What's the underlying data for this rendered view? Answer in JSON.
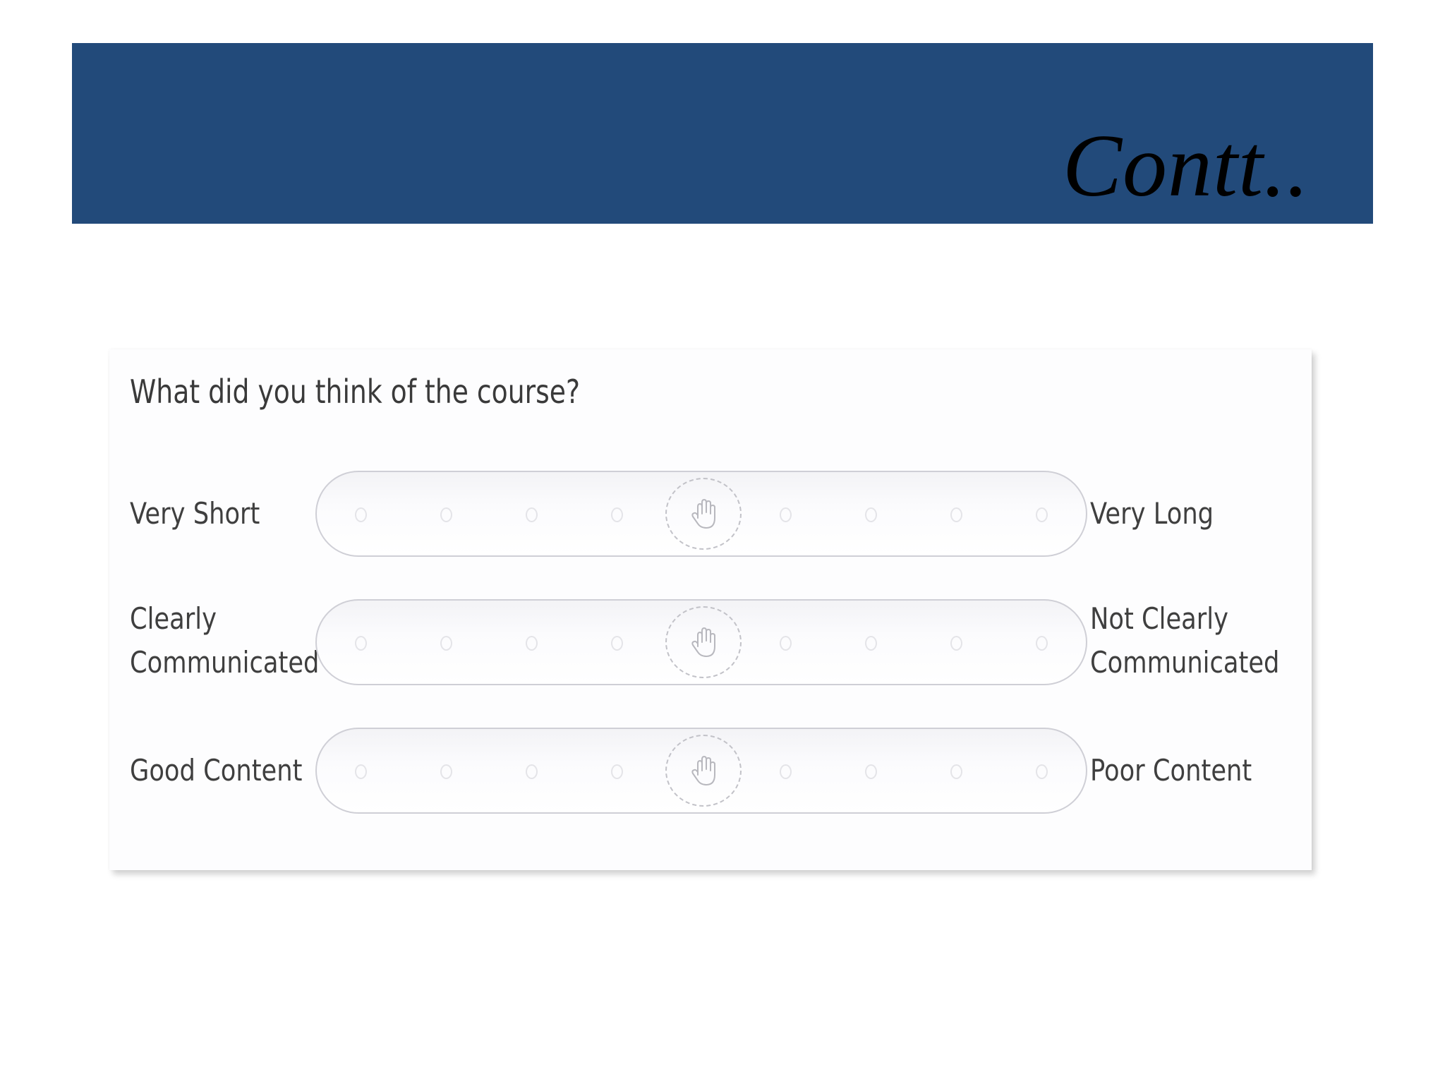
{
  "banner": {
    "title": "Contt..",
    "color": "#224a7a"
  },
  "survey": {
    "question": "What did you think of the course?",
    "rows": [
      {
        "left_label_lines": [
          "Very Short"
        ],
        "right_label_lines": [
          "Very Long"
        ],
        "scale_points": 9,
        "selected": null,
        "handle_icon": "hand-icon"
      },
      {
        "left_label_lines": [
          "Clearly",
          "Communicated"
        ],
        "right_label_lines": [
          "Not Clearly",
          "Communicated"
        ],
        "scale_points": 9,
        "selected": null,
        "handle_icon": "hand-icon"
      },
      {
        "left_label_lines": [
          "Good Content"
        ],
        "right_label_lines": [
          "Poor Content"
        ],
        "scale_points": 9,
        "selected": null,
        "handle_icon": "hand-icon"
      }
    ]
  }
}
